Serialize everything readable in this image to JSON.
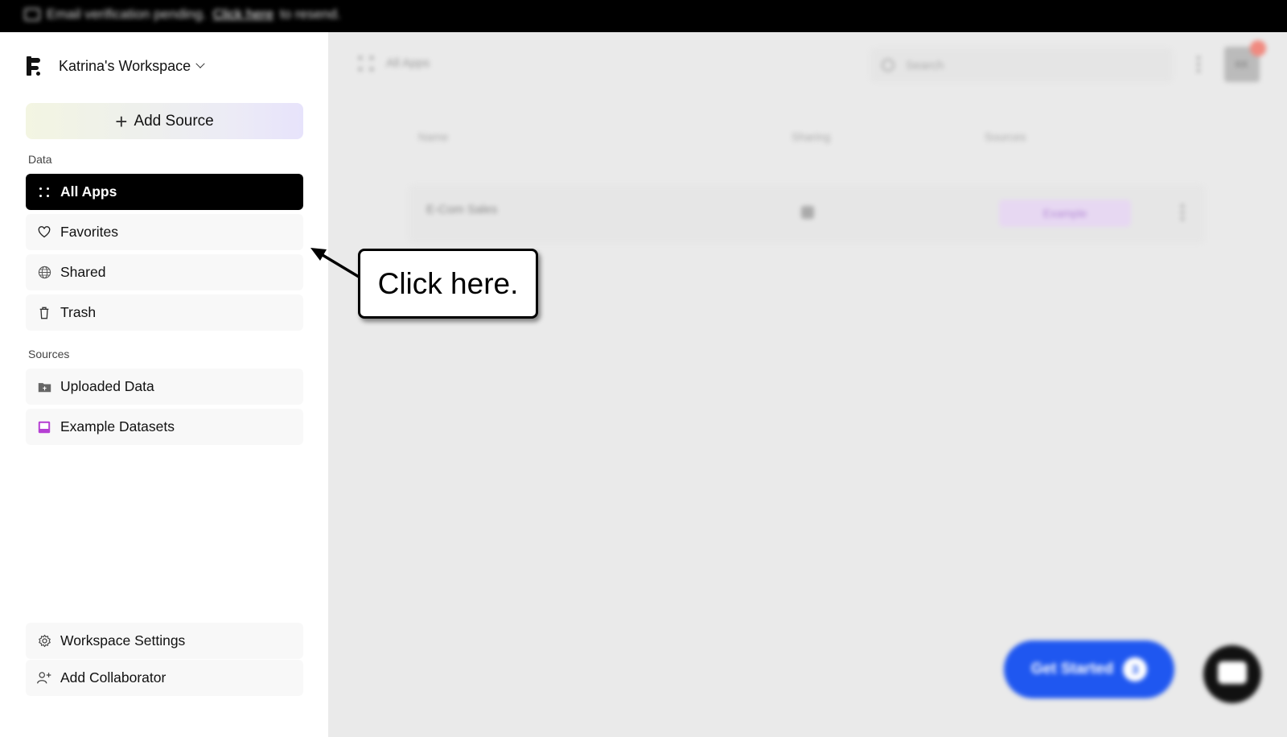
{
  "banner": {
    "text": "Email verification pending.",
    "link": "Click here",
    "suffix": "to resend."
  },
  "sidebar": {
    "workspace_name": "Katrina's Workspace",
    "add_source_label": "Add Source",
    "data_section_label": "Data",
    "data_items": [
      {
        "label": "All Apps",
        "icon": "grid-dots-icon",
        "active": true
      },
      {
        "label": "Favorites",
        "icon": "heart-icon",
        "active": false
      },
      {
        "label": "Shared",
        "icon": "globe-icon",
        "active": false
      },
      {
        "label": "Trash",
        "icon": "trash-icon",
        "active": false
      }
    ],
    "sources_section_label": "Sources",
    "source_items": [
      {
        "label": "Uploaded Data",
        "icon": "upload-folder-icon"
      },
      {
        "label": "Example Datasets",
        "icon": "dataset-icon"
      }
    ],
    "bottom_items": [
      {
        "label": "Workspace Settings",
        "icon": "gear-icon"
      },
      {
        "label": "Add Collaborator",
        "icon": "add-user-icon"
      }
    ]
  },
  "main": {
    "title": "All Apps",
    "search_placeholder": "Search",
    "avatar_initials": "KK",
    "columns": [
      "Name",
      "Sharing",
      "Sources"
    ],
    "rows": [
      {
        "name": "E-Com Sales",
        "source_badge": "Example"
      }
    ],
    "get_started_label": "Get Started",
    "get_started_count": "3"
  },
  "callout": {
    "text": "Click here."
  },
  "colors": {
    "active_nav": "#000000",
    "get_started": "#1f57f0",
    "example_badge": "#e7d8f2"
  }
}
